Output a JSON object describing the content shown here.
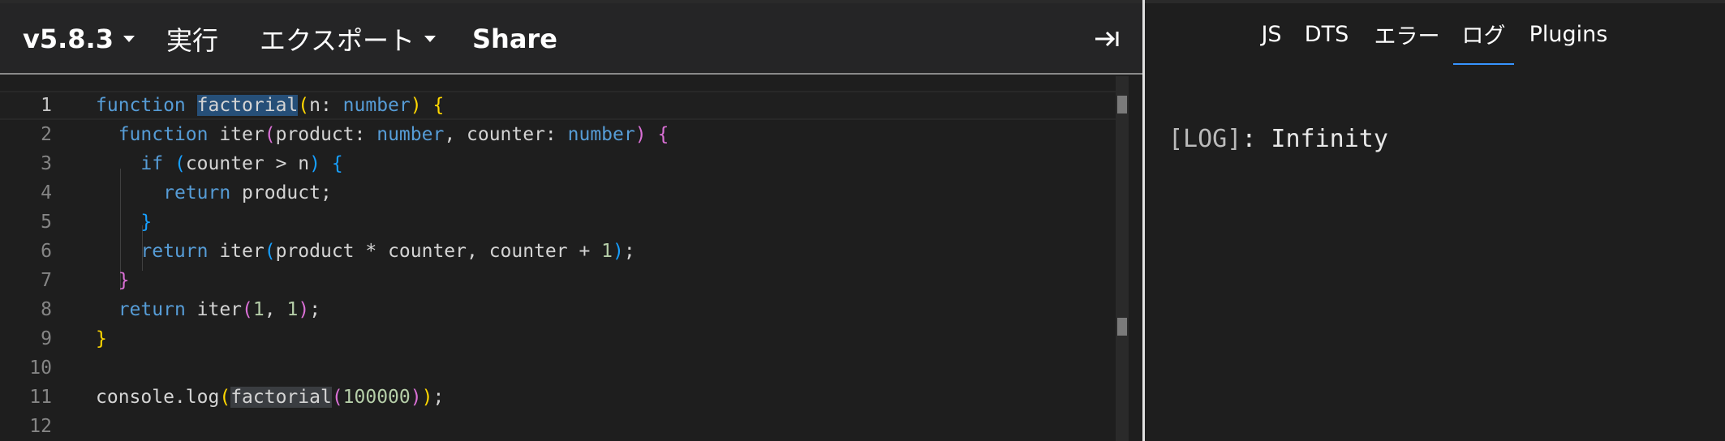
{
  "toolbar": {
    "version": "v5.8.3",
    "run": "実行",
    "export": "エクスポート",
    "share": "Share",
    "sidebar_toggle_icon": "arrow-to-right-icon"
  },
  "editor": {
    "lines": [
      {
        "number": "1",
        "text": "function factorial(n: number) {"
      },
      {
        "number": "2",
        "text": "  function iter(product: number, counter: number) {"
      },
      {
        "number": "3",
        "text": "    if (counter > n) {"
      },
      {
        "number": "4",
        "text": "      return product;"
      },
      {
        "number": "5",
        "text": "    }"
      },
      {
        "number": "6",
        "text": "    return iter(product * counter, counter + 1);"
      },
      {
        "number": "7",
        "text": "  }"
      },
      {
        "number": "8",
        "text": "  return iter(1, 1);"
      },
      {
        "number": "9",
        "text": "}"
      },
      {
        "number": "10",
        "text": ""
      },
      {
        "number": "11",
        "text": "console.log(factorial(100000));"
      },
      {
        "number": "12",
        "text": ""
      }
    ]
  },
  "output_tabs": [
    "JS",
    "DTS",
    "エラー",
    "ログ",
    "Plugins"
  ],
  "active_tab": "ログ",
  "log": {
    "prefix": "[LOG]",
    "message": ": Infinity"
  },
  "colors": {
    "accent": "#3794ff",
    "keyword": "#569cd6",
    "number": "#b5cea8",
    "bracket_level1": "#ffd700",
    "bracket_level2": "#da70d6",
    "bracket_level3": "#179fff"
  }
}
